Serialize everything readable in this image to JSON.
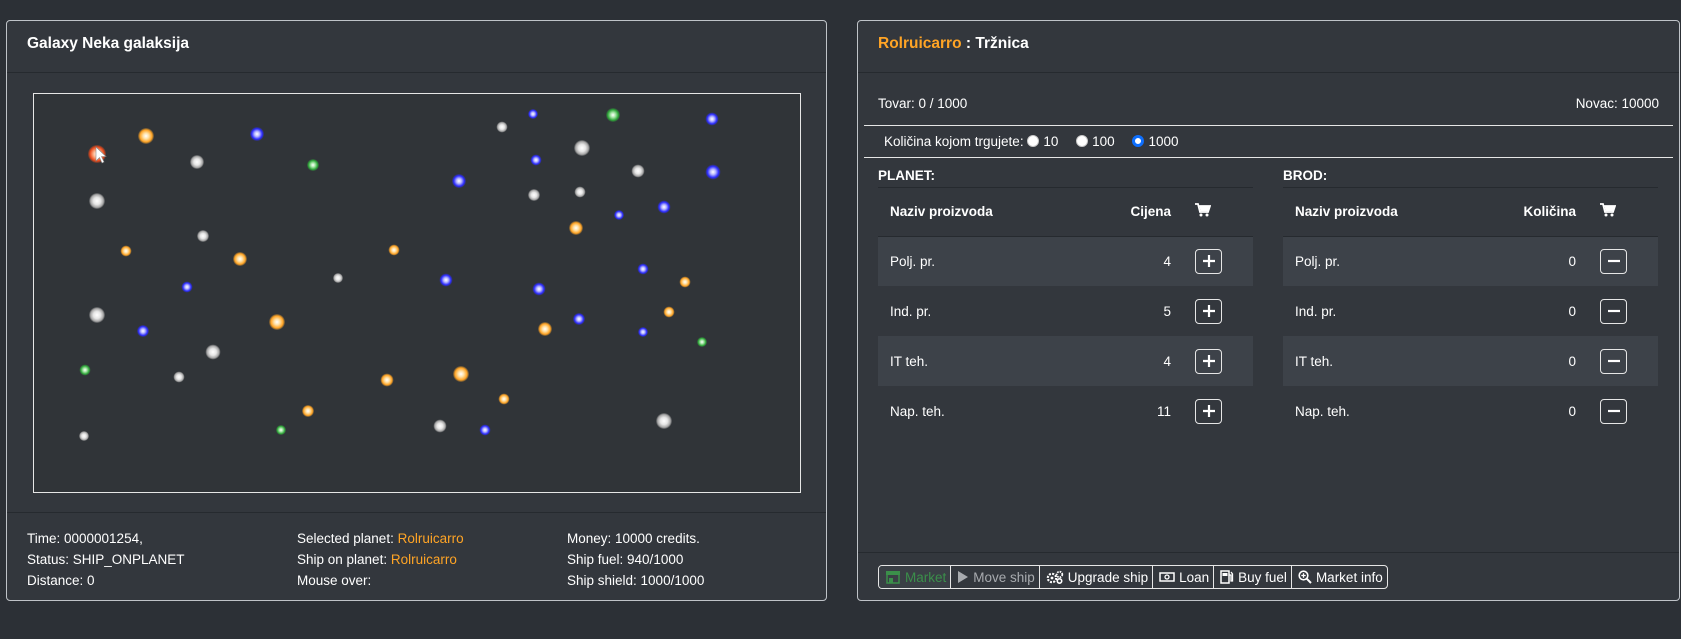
{
  "galaxy": {
    "title": "Galaxy Neka galaksija",
    "planet_colors": {
      "orange": "#ffa425",
      "gray": "#c8c8c8",
      "blue": "#3b3bff",
      "green": "#2fa83a",
      "selected": "#e84a1c"
    },
    "footer": {
      "time_label": "Time: 0000001254,",
      "status_label": "Status: SHIP_ONPLANET",
      "distance_label": "Distance: 0",
      "selected_planet_label": "Selected planet:",
      "selected_planet_value": "Rolruicarro",
      "ship_on_planet_label": "Ship on planet:",
      "ship_on_planet_value": "Rolruicarro",
      "mouse_over_label": "Mouse over:",
      "money_label": "Money: 10000 credits.",
      "fuel_label": "Ship fuel: 940/1000",
      "shield_label": "Ship shield: 1000/1000"
    }
  },
  "market": {
    "planet_name": "Rolruicarro",
    "title_suffix": ": Tržnica",
    "cargo_label": "Tovar: 0 / 1000",
    "money_label": "Novac: 10000",
    "qty_prompt": "Količina kojom trgujete:",
    "qty_options": [
      "10",
      "100",
      "1000"
    ],
    "qty_selected": "1000",
    "planet_section": {
      "title": "PLANET:",
      "col_name": "Naziv proizvoda",
      "col_price": "Cijena",
      "rows": [
        {
          "name": "Polj. pr.",
          "value": "4"
        },
        {
          "name": "Ind. pr.",
          "value": "5"
        },
        {
          "name": "IT teh.",
          "value": "4"
        },
        {
          "name": "Nap. teh.",
          "value": "11"
        }
      ]
    },
    "ship_section": {
      "title": "BROD:",
      "col_name": "Naziv proizvoda",
      "col_qty": "Količina",
      "rows": [
        {
          "name": "Polj. pr.",
          "value": "0"
        },
        {
          "name": "Ind. pr.",
          "value": "0"
        },
        {
          "name": "IT teh.",
          "value": "0"
        },
        {
          "name": "Nap. teh.",
          "value": "0"
        }
      ]
    },
    "actions": {
      "market": "Market",
      "move_ship": "Move ship",
      "upgrade_ship": "Upgrade ship",
      "loan": "Loan",
      "buy_fuel": "Buy fuel",
      "market_info": "Market info"
    }
  }
}
